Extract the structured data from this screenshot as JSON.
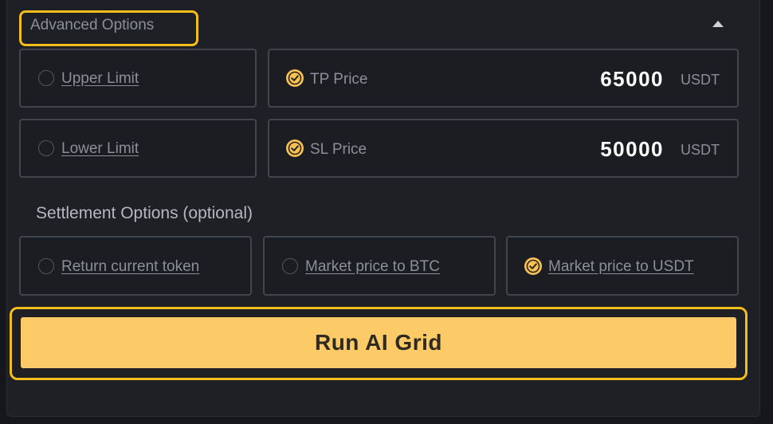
{
  "advanced": {
    "title": "Advanced Options",
    "collapse_icon": "caret-up-icon"
  },
  "limits": {
    "upper_label": "Upper Limit",
    "lower_label": "Lower Limit",
    "upper_checked": false,
    "lower_checked": false
  },
  "tp": {
    "label": "TP Price",
    "value": "65000",
    "unit": "USDT",
    "checked": true
  },
  "sl": {
    "label": "SL Price",
    "value": "50000",
    "unit": "USDT",
    "checked": true
  },
  "settlement": {
    "title": "Settlement Options (optional)",
    "options": [
      {
        "label": "Return current token",
        "checked": false
      },
      {
        "label": "Market price to BTC",
        "checked": false
      },
      {
        "label": "Market price to USDT",
        "checked": true
      }
    ]
  },
  "run_button": {
    "label": "Run AI Grid"
  },
  "colors": {
    "accent": "#f3be1c",
    "button": "#fcca66",
    "check": "#f7c156",
    "panel_bg": "#1e2026",
    "border": "#41454e"
  }
}
